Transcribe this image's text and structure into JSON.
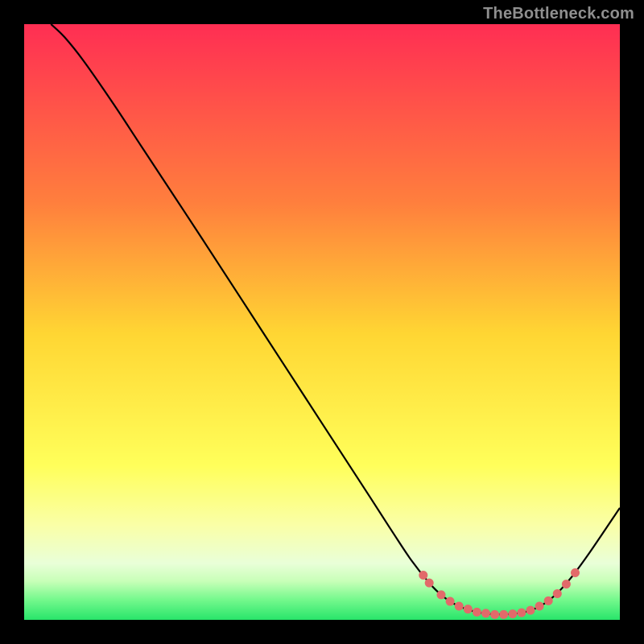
{
  "watermark": "TheBottleneck.com",
  "chart_data": {
    "type": "line",
    "title": "",
    "xlabel": "",
    "ylabel": "",
    "xlim": [
      0,
      100
    ],
    "ylim": [
      0,
      100
    ],
    "gradient_stops": [
      {
        "offset": 0,
        "color": "#ff2e53"
      },
      {
        "offset": 0.3,
        "color": "#ff7f3d"
      },
      {
        "offset": 0.52,
        "color": "#ffd633"
      },
      {
        "offset": 0.74,
        "color": "#ffff5a"
      },
      {
        "offset": 0.84,
        "color": "#faffa6"
      },
      {
        "offset": 0.905,
        "color": "#e9ffd8"
      },
      {
        "offset": 0.935,
        "color": "#c8ffb8"
      },
      {
        "offset": 0.965,
        "color": "#77f98e"
      },
      {
        "offset": 1.0,
        "color": "#28e56a"
      }
    ],
    "series": [
      {
        "name": "bottleneck-curve",
        "color": "#000000",
        "points": [
          {
            "x": 4.5,
            "y": 100.0
          },
          {
            "x": 6.8,
            "y": 97.8
          },
          {
            "x": 10.0,
            "y": 93.8
          },
          {
            "x": 15.0,
            "y": 86.6
          },
          {
            "x": 20.0,
            "y": 79.0
          },
          {
            "x": 30.0,
            "y": 63.8
          },
          {
            "x": 40.0,
            "y": 48.4
          },
          {
            "x": 50.0,
            "y": 33.0
          },
          {
            "x": 58.0,
            "y": 20.7
          },
          {
            "x": 62.0,
            "y": 14.5
          },
          {
            "x": 65.0,
            "y": 10.0
          },
          {
            "x": 68.0,
            "y": 6.2
          },
          {
            "x": 70.0,
            "y": 4.2
          },
          {
            "x": 72.0,
            "y": 2.8
          },
          {
            "x": 74.0,
            "y": 1.9
          },
          {
            "x": 76.0,
            "y": 1.3
          },
          {
            "x": 78.0,
            "y": 1.0
          },
          {
            "x": 80.0,
            "y": 0.9
          },
          {
            "x": 82.0,
            "y": 1.0
          },
          {
            "x": 84.0,
            "y": 1.3
          },
          {
            "x": 86.0,
            "y": 2.0
          },
          {
            "x": 88.0,
            "y": 3.2
          },
          {
            "x": 90.0,
            "y": 5.0
          },
          {
            "x": 92.0,
            "y": 7.3
          },
          {
            "x": 95.0,
            "y": 11.4
          },
          {
            "x": 100.0,
            "y": 18.8
          }
        ]
      },
      {
        "name": "highlight-dots",
        "color": "#e26a6a",
        "points": [
          {
            "x": 67.0,
            "y": 7.5
          },
          {
            "x": 68.0,
            "y": 6.2
          },
          {
            "x": 70.0,
            "y": 4.2
          },
          {
            "x": 71.5,
            "y": 3.1
          },
          {
            "x": 73.0,
            "y": 2.3
          },
          {
            "x": 74.5,
            "y": 1.8
          },
          {
            "x": 76.0,
            "y": 1.3
          },
          {
            "x": 77.5,
            "y": 1.1
          },
          {
            "x": 79.0,
            "y": 0.9
          },
          {
            "x": 80.5,
            "y": 0.9
          },
          {
            "x": 82.0,
            "y": 1.0
          },
          {
            "x": 83.5,
            "y": 1.2
          },
          {
            "x": 85.0,
            "y": 1.6
          },
          {
            "x": 86.5,
            "y": 2.3
          },
          {
            "x": 88.0,
            "y": 3.2
          },
          {
            "x": 89.5,
            "y": 4.4
          },
          {
            "x": 91.0,
            "y": 6.0
          },
          {
            "x": 92.5,
            "y": 7.9
          }
        ]
      }
    ]
  }
}
